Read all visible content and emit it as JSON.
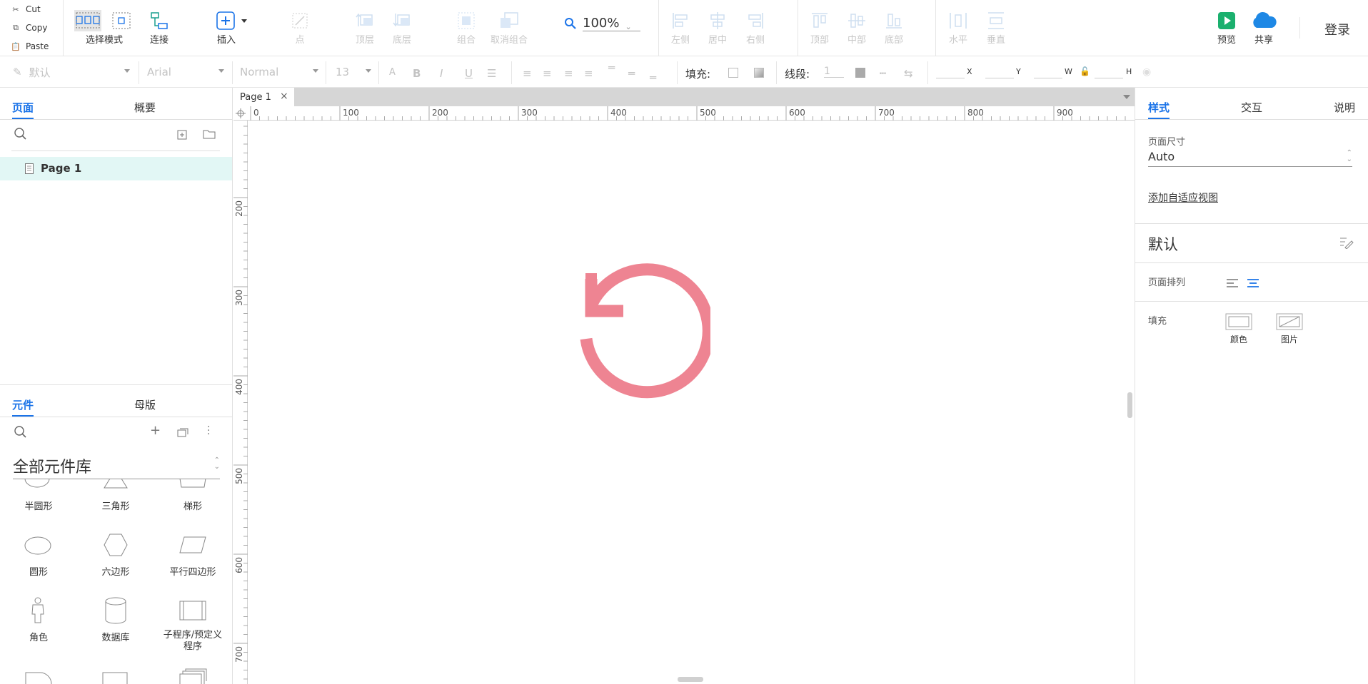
{
  "clipboard": {
    "cut": "Cut",
    "copy": "Copy",
    "paste": "Paste"
  },
  "toolbar": {
    "select_mode": "选择模式",
    "connect": "连接",
    "insert": "插入",
    "point": "点",
    "top_layer": "顶层",
    "bottom_layer": "底层",
    "group": "组合",
    "ungroup": "取消组合",
    "zoom": "100%",
    "align_left": "左侧",
    "align_center": "居中",
    "align_right": "右侧",
    "align_top": "顶部",
    "align_middle": "中部",
    "align_bottom": "底部",
    "distribute_h": "水平",
    "distribute_v": "垂直",
    "preview": "预览",
    "share": "共享",
    "login": "登录"
  },
  "format": {
    "style": "默认",
    "font": "Arial",
    "weight": "Normal",
    "size": "13",
    "fill_label": "填充:",
    "stroke_label": "线段:",
    "stroke_width": "1",
    "x": "X",
    "y": "Y",
    "w": "W",
    "h": "H"
  },
  "left": {
    "tab_pages": "页面",
    "tab_outline": "概要",
    "page_item": "Page 1",
    "tab_widgets": "元件",
    "tab_masters": "母版",
    "library": "全部元件库",
    "widgets": [
      "半圆形",
      "三角形",
      "梯形",
      "圆形",
      "六边形",
      "平行四边形",
      "角色",
      "数据库",
      "子程序/预定义程序"
    ]
  },
  "canvas": {
    "page_tab": "Page 1",
    "hruler": [
      "0",
      "100",
      "200",
      "300",
      "400",
      "500",
      "600",
      "700",
      "800",
      "900"
    ],
    "vruler": [
      "200",
      "300",
      "400",
      "500",
      "600",
      "700"
    ],
    "loading_color": "#ee8492"
  },
  "right": {
    "tab_style": "样式",
    "tab_interaction": "交互",
    "tab_notes": "说明",
    "page_size_label": "页面尺寸",
    "page_size_value": "Auto",
    "adaptive_link": "添加自适应视图",
    "default_title": "默认",
    "page_align_label": "页面排列",
    "fill_label": "填充",
    "fill_color": "颜色",
    "fill_image": "图片"
  },
  "colors": {
    "accent": "#1a73e8",
    "preview_green": "#1bb06e",
    "share_blue": "#1e88e5",
    "disabled": "#c3c3c3"
  }
}
